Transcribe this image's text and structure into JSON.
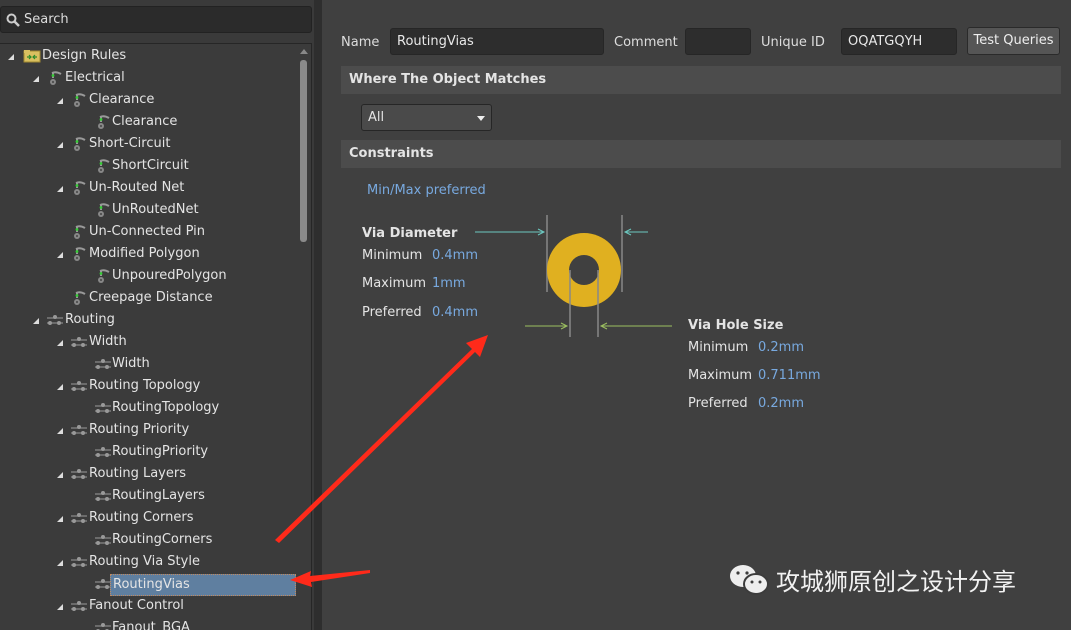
{
  "search": {
    "placeholder": "Search",
    "icon": "search-icon"
  },
  "tree": [
    {
      "label": "Design Rules",
      "level": 0,
      "arrow": true,
      "icon": "folder-rules"
    },
    {
      "label": "Electrical",
      "level": 1,
      "arrow": true,
      "icon": "electrical"
    },
    {
      "label": "Clearance",
      "level": 2,
      "arrow": true,
      "icon": "electrical"
    },
    {
      "label": "Clearance",
      "level": 3,
      "arrow": false,
      "icon": "electrical"
    },
    {
      "label": "Short-Circuit",
      "level": 2,
      "arrow": true,
      "icon": "electrical"
    },
    {
      "label": "ShortCircuit",
      "level": 3,
      "arrow": false,
      "icon": "electrical"
    },
    {
      "label": "Un-Routed Net",
      "level": 2,
      "arrow": true,
      "icon": "electrical"
    },
    {
      "label": "UnRoutedNet",
      "level": 3,
      "arrow": false,
      "icon": "electrical"
    },
    {
      "label": "Un-Connected Pin",
      "level": 2,
      "arrow": false,
      "icon": "electrical"
    },
    {
      "label": "Modified Polygon",
      "level": 2,
      "arrow": true,
      "icon": "electrical"
    },
    {
      "label": "UnpouredPolygon",
      "level": 3,
      "arrow": false,
      "icon": "electrical"
    },
    {
      "label": "Creepage Distance",
      "level": 2,
      "arrow": false,
      "icon": "electrical"
    },
    {
      "label": "Routing",
      "level": 1,
      "arrow": true,
      "icon": "routing"
    },
    {
      "label": "Width",
      "level": 2,
      "arrow": true,
      "icon": "routing"
    },
    {
      "label": "Width",
      "level": 3,
      "arrow": false,
      "icon": "routing"
    },
    {
      "label": "Routing Topology",
      "level": 2,
      "arrow": true,
      "icon": "routing"
    },
    {
      "label": "RoutingTopology",
      "level": 3,
      "arrow": false,
      "icon": "routing"
    },
    {
      "label": "Routing Priority",
      "level": 2,
      "arrow": true,
      "icon": "routing"
    },
    {
      "label": "RoutingPriority",
      "level": 3,
      "arrow": false,
      "icon": "routing"
    },
    {
      "label": "Routing Layers",
      "level": 2,
      "arrow": true,
      "icon": "routing"
    },
    {
      "label": "RoutingLayers",
      "level": 3,
      "arrow": false,
      "icon": "routing"
    },
    {
      "label": "Routing Corners",
      "level": 2,
      "arrow": true,
      "icon": "routing"
    },
    {
      "label": "RoutingCorners",
      "level": 3,
      "arrow": false,
      "icon": "routing"
    },
    {
      "label": "Routing Via Style",
      "level": 2,
      "arrow": true,
      "icon": "routing"
    },
    {
      "label": "RoutingVias",
      "level": 3,
      "arrow": false,
      "icon": "routing",
      "selected": true
    },
    {
      "label": "Fanout Control",
      "level": 2,
      "arrow": true,
      "icon": "routing"
    },
    {
      "label": "Fanout_BGA",
      "level": 3,
      "arrow": false,
      "icon": "routing"
    }
  ],
  "form": {
    "name_label": "Name",
    "name_value": "RoutingVias",
    "comment_label": "Comment",
    "comment_value": "",
    "uid_label": "Unique ID",
    "uid_value": "OQATGQYH",
    "test_queries": "Test Queries"
  },
  "where": {
    "title": "Where The Object Matches",
    "selected": "All"
  },
  "constraints": {
    "title": "Constraints",
    "mode": "Min/Max preferred",
    "via_diameter": {
      "title": "Via Diameter",
      "minimum_label": "Minimum",
      "minimum": "0.4mm",
      "maximum_label": "Maximum",
      "maximum": "1mm",
      "preferred_label": "Preferred",
      "preferred": "0.4mm"
    },
    "via_hole": {
      "title": "Via Hole Size",
      "minimum_label": "Minimum",
      "minimum": "0.2mm",
      "maximum_label": "Maximum",
      "maximum": "0.711mm",
      "preferred_label": "Preferred",
      "preferred": "0.2mm"
    }
  },
  "colors": {
    "via_pad": "#e0b020",
    "selection": "#5f7fa0",
    "value_text": "#78a9df",
    "annotation_arrow": "#ff2a1a"
  },
  "watermark": {
    "text": "攻城狮原创之设计分享",
    "icon": "wechat-icon"
  }
}
